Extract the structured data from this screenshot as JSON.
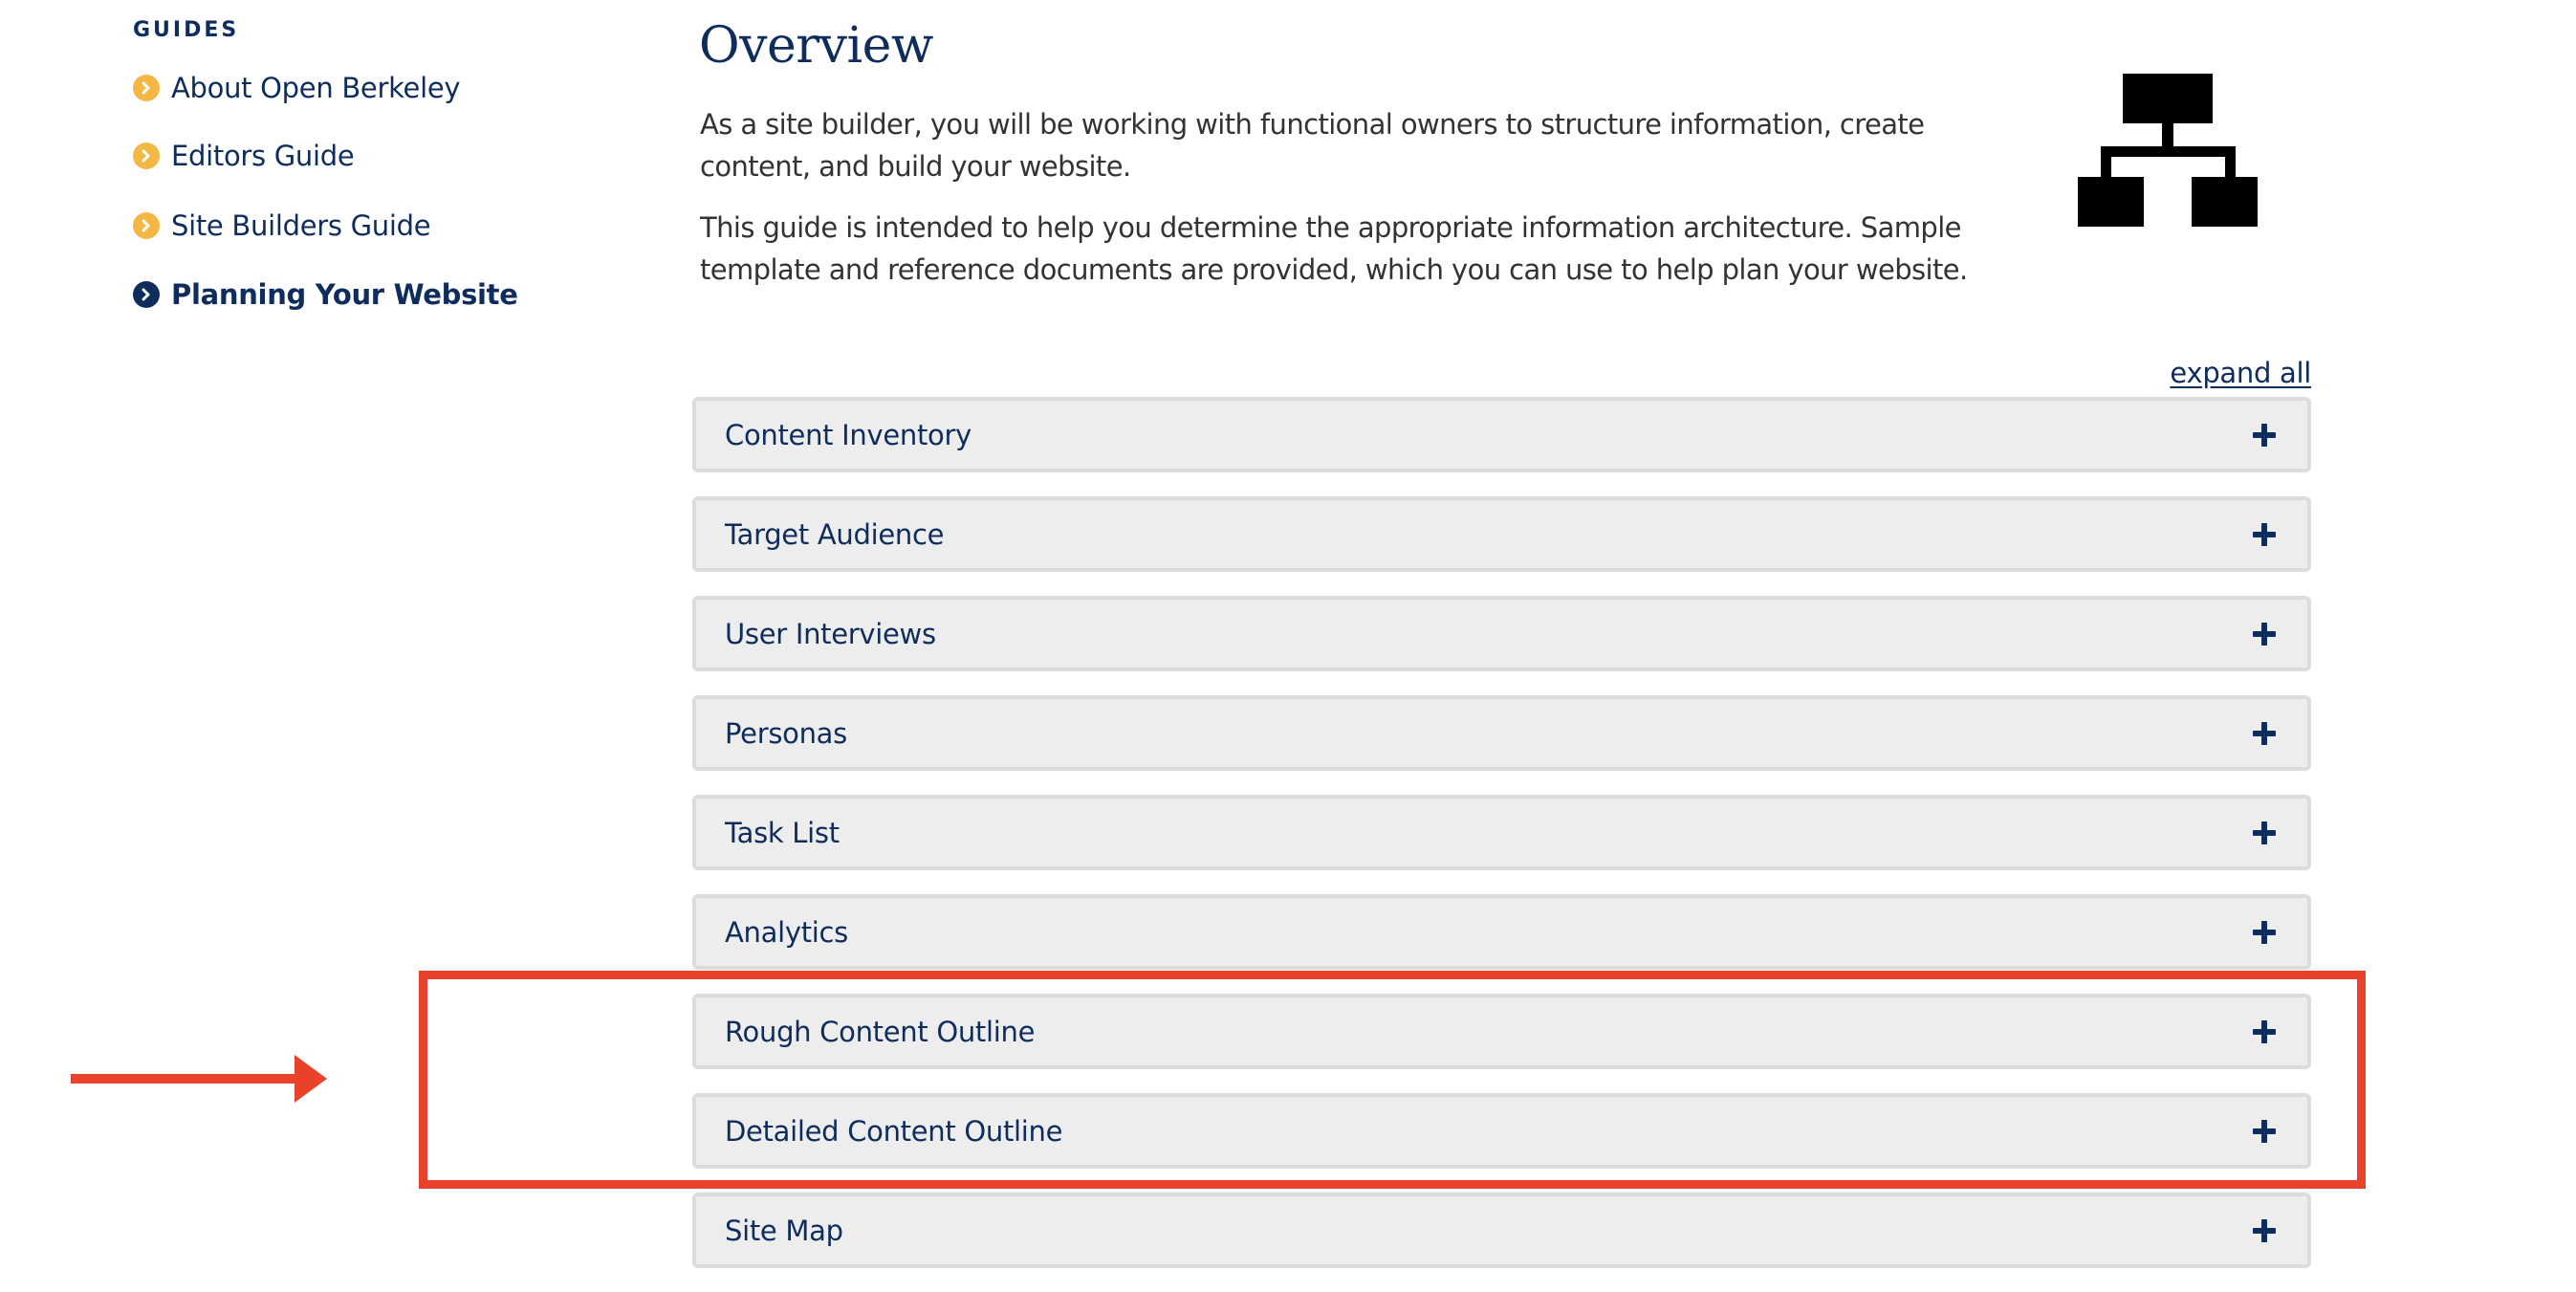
{
  "sidebar": {
    "heading": "GUIDES",
    "items": [
      {
        "label": "About Open Berkeley",
        "active": false
      },
      {
        "label": "Editors Guide",
        "active": false
      },
      {
        "label": "Site Builders Guide",
        "active": false
      },
      {
        "label": "Planning Your Website",
        "active": true
      }
    ]
  },
  "main": {
    "title": "Overview",
    "paragraphs": [
      "As a site builder, you will be working with functional owners to structure information, create content, and build your website.",
      "This guide is intended to help you determine the appropriate information architecture. Sample template and reference documents are provided, which you can use to help plan your website."
    ],
    "illustration_icon": "sitemap-hierarchy-icon",
    "expand_all_label": "expand all",
    "accordion": [
      {
        "label": "Content Inventory",
        "expanded": false
      },
      {
        "label": "Target Audience",
        "expanded": false
      },
      {
        "label": "User Interviews",
        "expanded": false
      },
      {
        "label": "Personas",
        "expanded": false
      },
      {
        "label": "Task List",
        "expanded": false
      },
      {
        "label": "Analytics",
        "expanded": false
      },
      {
        "label": "Rough Content Outline",
        "expanded": false
      },
      {
        "label": "Detailed Content Outline",
        "expanded": false
      },
      {
        "label": "Site Map",
        "expanded": false
      }
    ]
  },
  "annotation": {
    "highlighted_items": [
      "Rough Content Outline",
      "Detailed Content Outline"
    ],
    "color": "#e8432a"
  },
  "colors": {
    "navy": "#0f2d5c",
    "gold": "#f2b843",
    "accordion_bg": "#ededed",
    "accordion_border": "#dcdcdc",
    "body_text": "#333333"
  }
}
